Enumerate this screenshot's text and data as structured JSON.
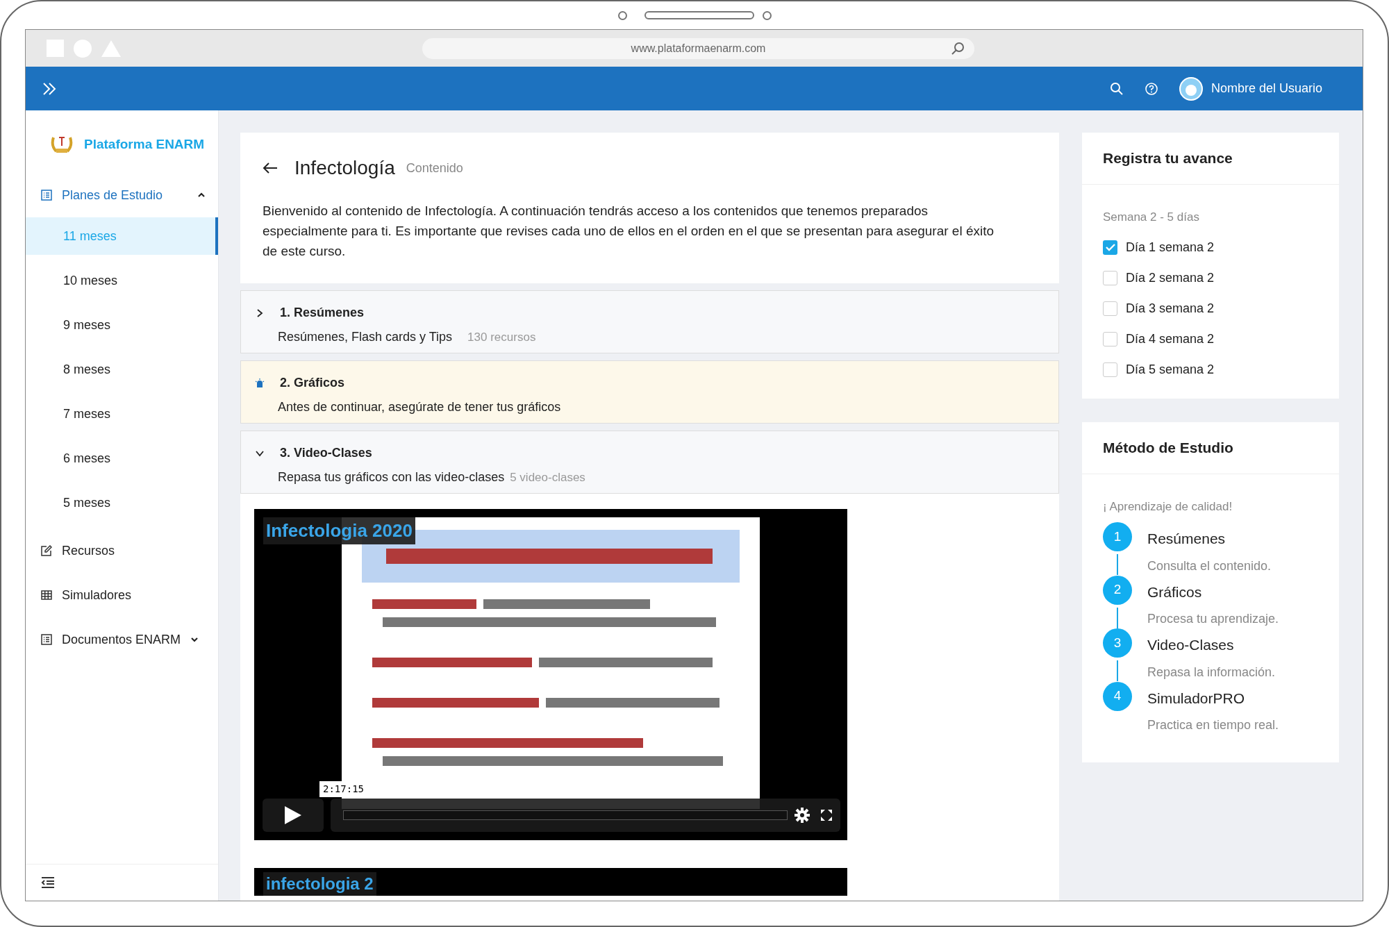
{
  "browser": {
    "url": "www.plataformaenarm.com"
  },
  "header": {
    "user_name": "Nombre del Usuario"
  },
  "sidebar": {
    "brand": "Plataforma ENARM",
    "items": [
      {
        "label": "Planes de Estudio",
        "kind": "group",
        "expanded": true,
        "children": [
          {
            "label": "11 meses",
            "selected": true
          },
          {
            "label": "10 meses",
            "selected": false
          },
          {
            "label": "9 meses",
            "selected": false
          },
          {
            "label": "8 meses",
            "selected": false
          },
          {
            "label": "7 meses",
            "selected": false
          },
          {
            "label": "6 meses",
            "selected": false
          },
          {
            "label": "5 meses",
            "selected": false
          }
        ]
      },
      {
        "label": "Recursos",
        "kind": "link"
      },
      {
        "label": "Simuladores",
        "kind": "link"
      },
      {
        "label": "Documentos ENARM",
        "kind": "group",
        "expanded": false
      }
    ]
  },
  "content": {
    "title": "Infectología",
    "subtitle": "Contenido",
    "intro": "Bienvenido al contenido de Infectología. A continuación tendrás acceso a los contenidos que tenemos preparados especialmente para ti. Es importante que revises cada uno de ellos en el orden en el que se presentan para asegurar el éxito de este curso.",
    "sections": [
      {
        "kind": "collapsible",
        "expanded": false,
        "title": "1. Resúmenes",
        "description": "Resúmenes, Flash cards y Tips",
        "count": "130 recursos"
      },
      {
        "kind": "notice",
        "title": "2. Gráficos",
        "description": "Antes de continuar, asegúrate de tener tus gráficos"
      },
      {
        "kind": "collapsible",
        "expanded": true,
        "title": "3. Video-Clases",
        "description": "Repasa tus gráficos con las video-clases",
        "count": "5 video-clases"
      }
    ],
    "videos": [
      {
        "title": "Infectologia 2020",
        "time": "2:17:15"
      },
      {
        "title": "infectologia 2"
      }
    ]
  },
  "progress": {
    "title": "Registra tu avance",
    "week": "Semana 2 - 5 días",
    "days": [
      {
        "label": "Día 1 semana 2",
        "checked": true
      },
      {
        "label": "Día 2 semana 2",
        "checked": false
      },
      {
        "label": "Día 3 semana 2",
        "checked": false
      },
      {
        "label": "Día 4 semana 2",
        "checked": false
      },
      {
        "label": "Día 5 semana 2",
        "checked": false
      }
    ]
  },
  "method": {
    "title": "Método de Estudio",
    "tagline": "¡ Aprendizaje de calidad!",
    "steps": [
      {
        "number": "1",
        "title": "Resúmenes",
        "description": "Consulta el contenido."
      },
      {
        "number": "2",
        "title": "Gráficos",
        "description": "Procesa tu aprendizaje."
      },
      {
        "number": "3",
        "title": "Video-Clases",
        "description": "Repasa la información."
      },
      {
        "number": "4",
        "title": "SimuladorPRO",
        "description": "Practica en tiempo real."
      }
    ]
  }
}
